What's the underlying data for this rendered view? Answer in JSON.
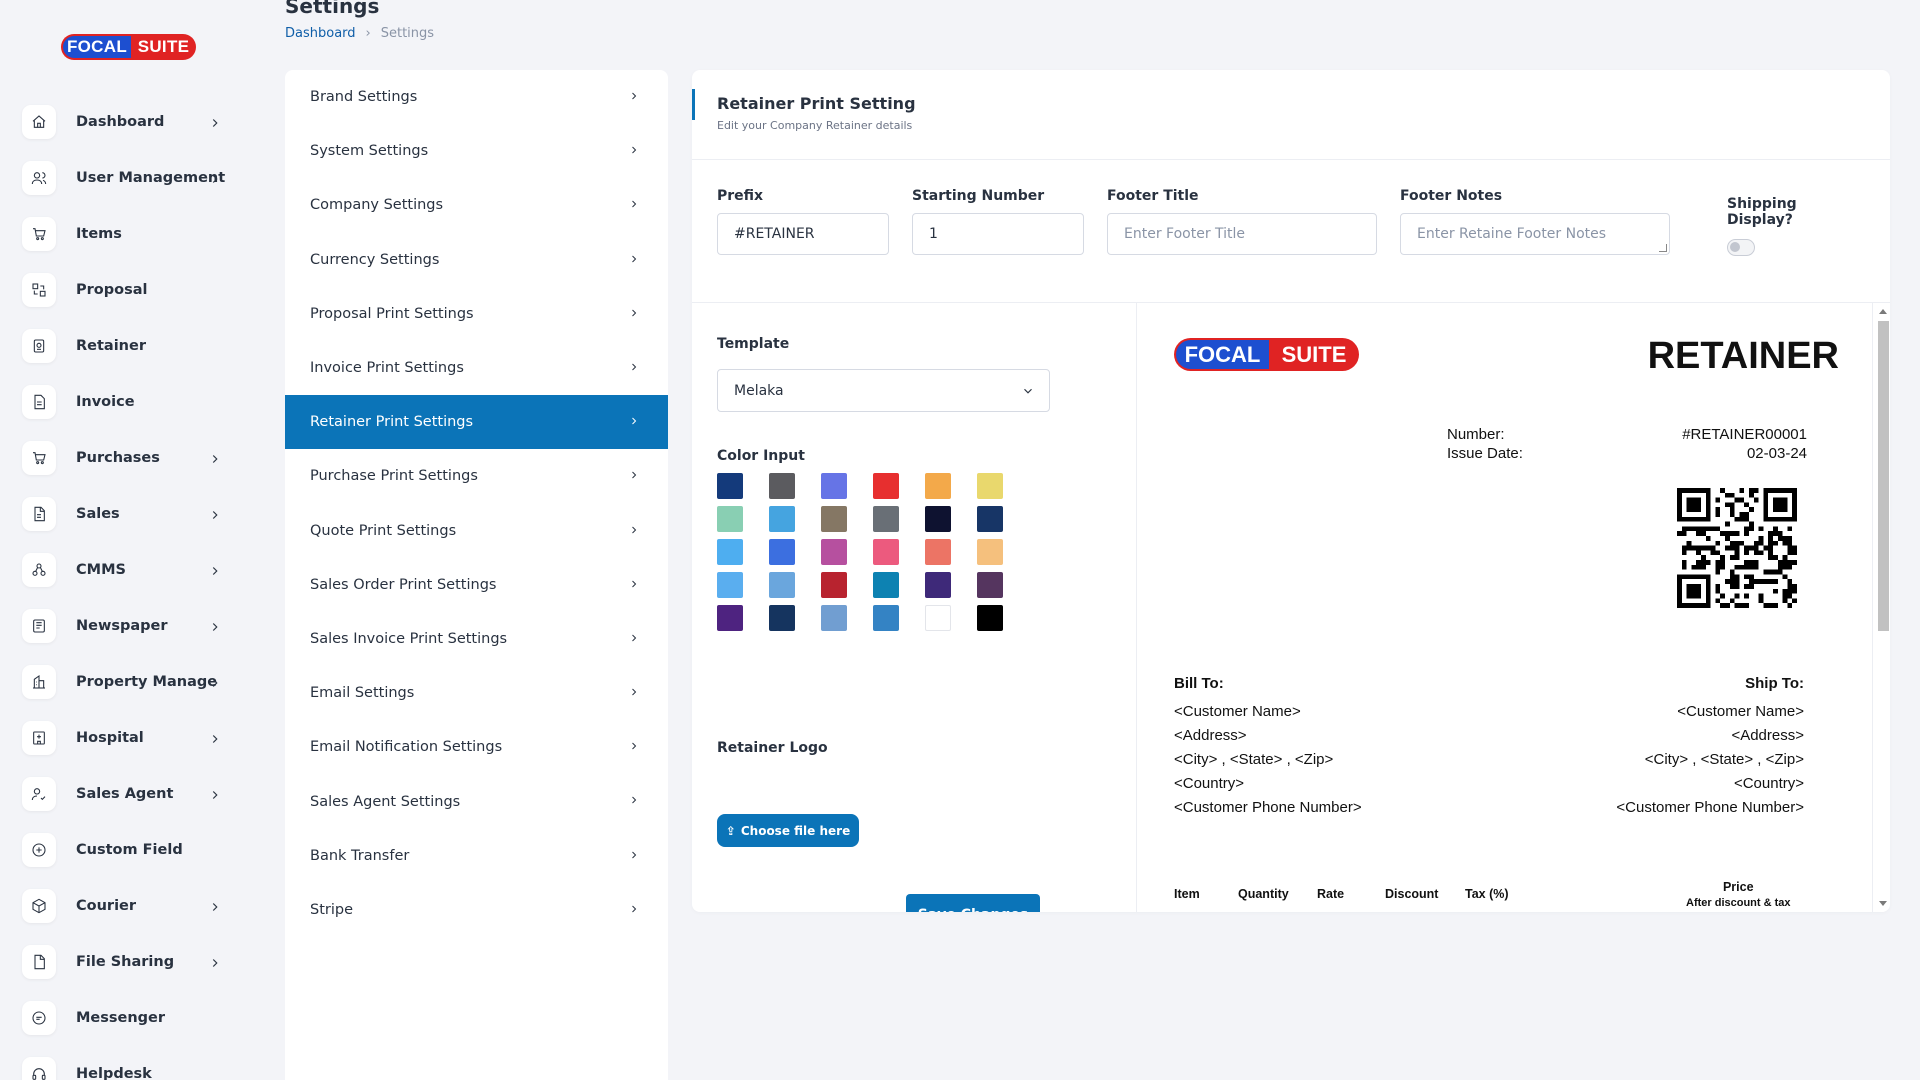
{
  "brand": {
    "logo_part1": "FOCAL",
    "logo_part2": "SUITE"
  },
  "sidebar": {
    "items": [
      {
        "label": "Dashboard",
        "icon": "home-icon",
        "has_children": true
      },
      {
        "label": "User Management",
        "icon": "users-icon",
        "has_children": true
      },
      {
        "label": "Items",
        "icon": "cart-icon",
        "has_children": false
      },
      {
        "label": "Proposal",
        "icon": "proposal-icon",
        "has_children": false
      },
      {
        "label": "Retainer",
        "icon": "retainer-icon",
        "has_children": false
      },
      {
        "label": "Invoice",
        "icon": "invoice-icon",
        "has_children": false
      },
      {
        "label": "Purchases",
        "icon": "cart-icon",
        "has_children": true
      },
      {
        "label": "Sales",
        "icon": "document-icon",
        "has_children": true
      },
      {
        "label": "CMMS",
        "icon": "network-icon",
        "has_children": true
      },
      {
        "label": "Newspaper",
        "icon": "newspaper-icon",
        "has_children": true
      },
      {
        "label": "Property Manage",
        "icon": "building-icon",
        "has_children": true
      },
      {
        "label": "Hospital",
        "icon": "hospital-icon",
        "has_children": true
      },
      {
        "label": "Sales Agent",
        "icon": "user-check-icon",
        "has_children": true
      },
      {
        "label": "Custom Field",
        "icon": "plus-circle-icon",
        "has_children": false
      },
      {
        "label": "Courier",
        "icon": "package-icon",
        "has_children": true
      },
      {
        "label": "File Sharing",
        "icon": "file-icon",
        "has_children": true
      },
      {
        "label": "Messenger",
        "icon": "message-icon",
        "has_children": false
      },
      {
        "label": "Helpdesk",
        "icon": "headset-icon",
        "has_children": false
      }
    ]
  },
  "header": {
    "title": "Settings",
    "breadcrumb": [
      "Dashboard",
      "Settings"
    ]
  },
  "settings_menu": {
    "active_index": 6,
    "items": [
      "Brand Settings",
      "System Settings",
      "Company Settings",
      "Currency Settings",
      "Proposal Print Settings",
      "Invoice Print Settings",
      "Retainer Print Settings",
      "Purchase Print Settings",
      "Quote Print Settings",
      "Sales Order Print Settings",
      "Sales Invoice Print Settings",
      "Email Settings",
      "Email Notification Settings",
      "Sales Agent Settings",
      "Bank Transfer",
      "Stripe"
    ]
  },
  "card": {
    "title": "Retainer Print Setting",
    "subtitle": "Edit your Company Retainer details",
    "fields": {
      "prefix": {
        "label": "Prefix",
        "value": "#RETAINER"
      },
      "starting_number": {
        "label": "Starting Number",
        "value": "1"
      },
      "footer_title": {
        "label": "Footer Title",
        "placeholder": "Enter Footer Title"
      },
      "footer_notes": {
        "label": "Footer Notes",
        "placeholder": "Enter Retaine Footer Notes"
      },
      "shipping_display": {
        "label": "Shipping Display?",
        "enabled": false
      }
    },
    "template": {
      "label": "Template",
      "value": "Melaka"
    },
    "color_input": {
      "label": "Color Input",
      "swatches": [
        "#143a7b",
        "#5b5b5f",
        "#6674e6",
        "#e72f2f",
        "#f3a94a",
        "#e9d86d",
        "#89cfb3",
        "#45a4e0",
        "#857764",
        "#696f76",
        "#0e1230",
        "#173566",
        "#4eaef0",
        "#3c6fe0",
        "#b6509f",
        "#ec5a7e",
        "#ec7465",
        "#f5c07d",
        "#5aaeef",
        "#6aa6dd",
        "#b8232f",
        "#0d82b2",
        "#3e2979",
        "#55355f",
        "#4e2380",
        "#15345f",
        "#719ed1",
        "#3483c4",
        "#ffffff",
        "#000000"
      ]
    },
    "logo": {
      "label": "Retainer Logo",
      "button": "Choose file here"
    },
    "save_button": "Save Changes"
  },
  "preview": {
    "logo_part1": "FOCAL",
    "logo_part2": "SUITE",
    "title": "RETAINER",
    "number_label": "Number:",
    "number_value": "#RETAINER00001",
    "date_label": "Issue Date:",
    "date_value": "02-03-24",
    "bill_to": {
      "heading": "Bill To:",
      "lines": [
        "<Customer Name>",
        "<Address>",
        "<City> , <State> , <Zip>",
        "<Country>",
        "<Customer Phone Number>"
      ]
    },
    "ship_to": {
      "heading": "Ship To:",
      "lines": [
        "<Customer Name>",
        "<Address>",
        "<City> , <State> , <Zip>",
        "<Country>",
        "<Customer Phone Number>"
      ]
    },
    "table_headers": {
      "item": "Item",
      "quantity": "Quantity",
      "rate": "Rate",
      "discount": "Discount",
      "tax": "Tax (%)",
      "price": "Price",
      "price_note": "After discount & tax"
    }
  }
}
